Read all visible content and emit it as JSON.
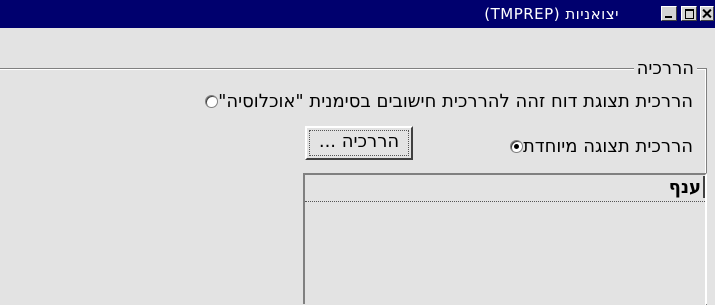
{
  "window": {
    "title": "יצואניות (TMPREP)"
  },
  "group": {
    "legend": "הררכיה"
  },
  "options": [
    {
      "label": "הררכית תצוגת דוח זהה להררכית חישובים בסימנית \"אוכלוסיה\"",
      "checked": false
    },
    {
      "label": "הררכית תצוגה מיוחדת",
      "checked": true
    }
  ],
  "hierarchy_button": {
    "label": "הררכיה ..."
  },
  "list": {
    "header": "ענף",
    "items": []
  },
  "colors": {
    "titlebar": "#00006e",
    "face": "#e3e3e3"
  },
  "icons": [
    "close-icon",
    "maximize-icon",
    "minimize-icon"
  ]
}
